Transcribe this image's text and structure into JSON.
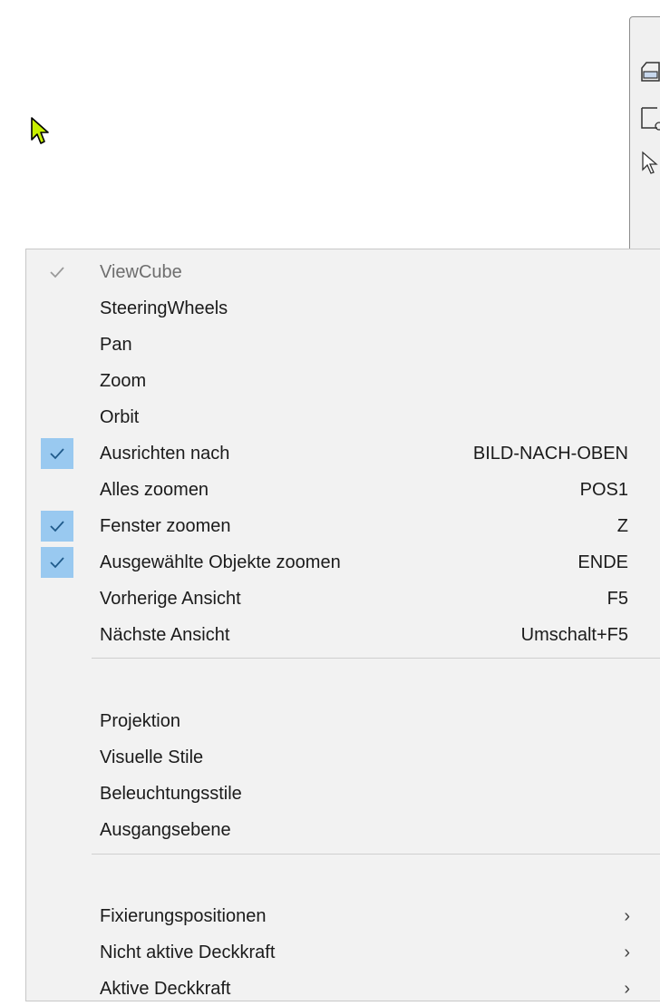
{
  "menu": {
    "items": [
      {
        "label": "ViewCube",
        "shortcut": "",
        "checked": "gray",
        "disabled": true,
        "submenu": false
      },
      {
        "label": "SteeringWheels",
        "shortcut": "",
        "checked": "",
        "disabled": false,
        "submenu": false
      },
      {
        "label": "Pan",
        "shortcut": "",
        "checked": "",
        "disabled": false,
        "submenu": false
      },
      {
        "label": "Zoom",
        "shortcut": "",
        "checked": "",
        "disabled": false,
        "submenu": false
      },
      {
        "label": "Orbit",
        "shortcut": "",
        "checked": "",
        "disabled": false,
        "submenu": false
      },
      {
        "label": "Ausrichten nach",
        "shortcut": "BILD-NACH-OBEN",
        "checked": "blue",
        "disabled": false,
        "submenu": false
      },
      {
        "label": "Alles zoomen",
        "shortcut": "POS1",
        "checked": "",
        "disabled": false,
        "submenu": false
      },
      {
        "label": "Fenster zoomen",
        "shortcut": "Z",
        "checked": "blue",
        "disabled": false,
        "submenu": false
      },
      {
        "label": "Ausgewählte Objekte zoomen",
        "shortcut": "ENDE",
        "checked": "blue",
        "disabled": false,
        "submenu": false
      },
      {
        "label": "Vorherige Ansicht",
        "shortcut": "F5",
        "checked": "",
        "disabled": false,
        "submenu": false
      },
      {
        "label": "Nächste Ansicht",
        "shortcut": "Umschalt+F5",
        "checked": "",
        "disabled": false,
        "submenu": false
      },
      {
        "label": "Projektion",
        "shortcut": "",
        "checked": "",
        "disabled": false,
        "submenu": false
      },
      {
        "label": "Visuelle Stile",
        "shortcut": "",
        "checked": "",
        "disabled": false,
        "submenu": false
      },
      {
        "label": "Beleuchtungsstile",
        "shortcut": "",
        "checked": "",
        "disabled": false,
        "submenu": false
      },
      {
        "label": "Ausgangsebene",
        "shortcut": "",
        "checked": "",
        "disabled": false,
        "submenu": false
      },
      {
        "label": "Fixierungspositionen",
        "shortcut": "",
        "checked": "",
        "disabled": false,
        "submenu": true
      },
      {
        "label": "Nicht aktive Deckkraft",
        "shortcut": "",
        "checked": "",
        "disabled": false,
        "submenu": true
      },
      {
        "label": "Aktive Deckkraft",
        "shortcut": "",
        "checked": "",
        "disabled": false,
        "submenu": true
      }
    ],
    "submenu_glyph": "›",
    "check_color": "#99c9f0"
  },
  "toolbar": {
    "icons": [
      "folder-icon",
      "rectangle-window-icon",
      "cursor-select-icon"
    ]
  }
}
